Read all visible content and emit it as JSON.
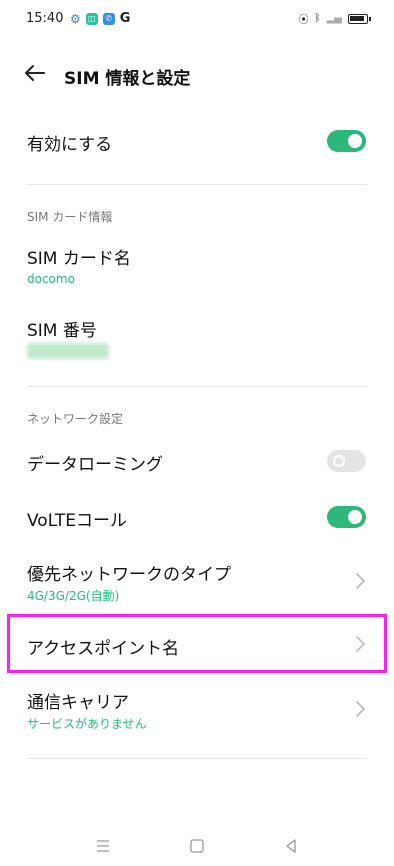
{
  "status_bar": {
    "time": "15:40"
  },
  "header": {
    "title": "SIM 情報と設定"
  },
  "enable": {
    "label": "有効にする",
    "enabled": true
  },
  "sim_card_section": {
    "label": "SIM カード情報",
    "sim_name": {
      "title": "SIM カード名",
      "value": "docomo"
    },
    "sim_number": {
      "title": "SIM 番号"
    }
  },
  "network_section": {
    "label": "ネットワーク設定",
    "data_roaming": {
      "label": "データローミング",
      "enabled": false
    },
    "volte": {
      "label": "VoLTEコール",
      "enabled": true
    },
    "preferred_network": {
      "title": "優先ネットワークのタイプ",
      "value": "4G/3G/2G(自動)"
    },
    "apn": {
      "title": "アクセスポイント名"
    },
    "carrier": {
      "title": "通信キャリア",
      "value": "サービスがありません"
    }
  },
  "colors": {
    "accent": "#2db87a",
    "highlight": "#ff22ee"
  }
}
